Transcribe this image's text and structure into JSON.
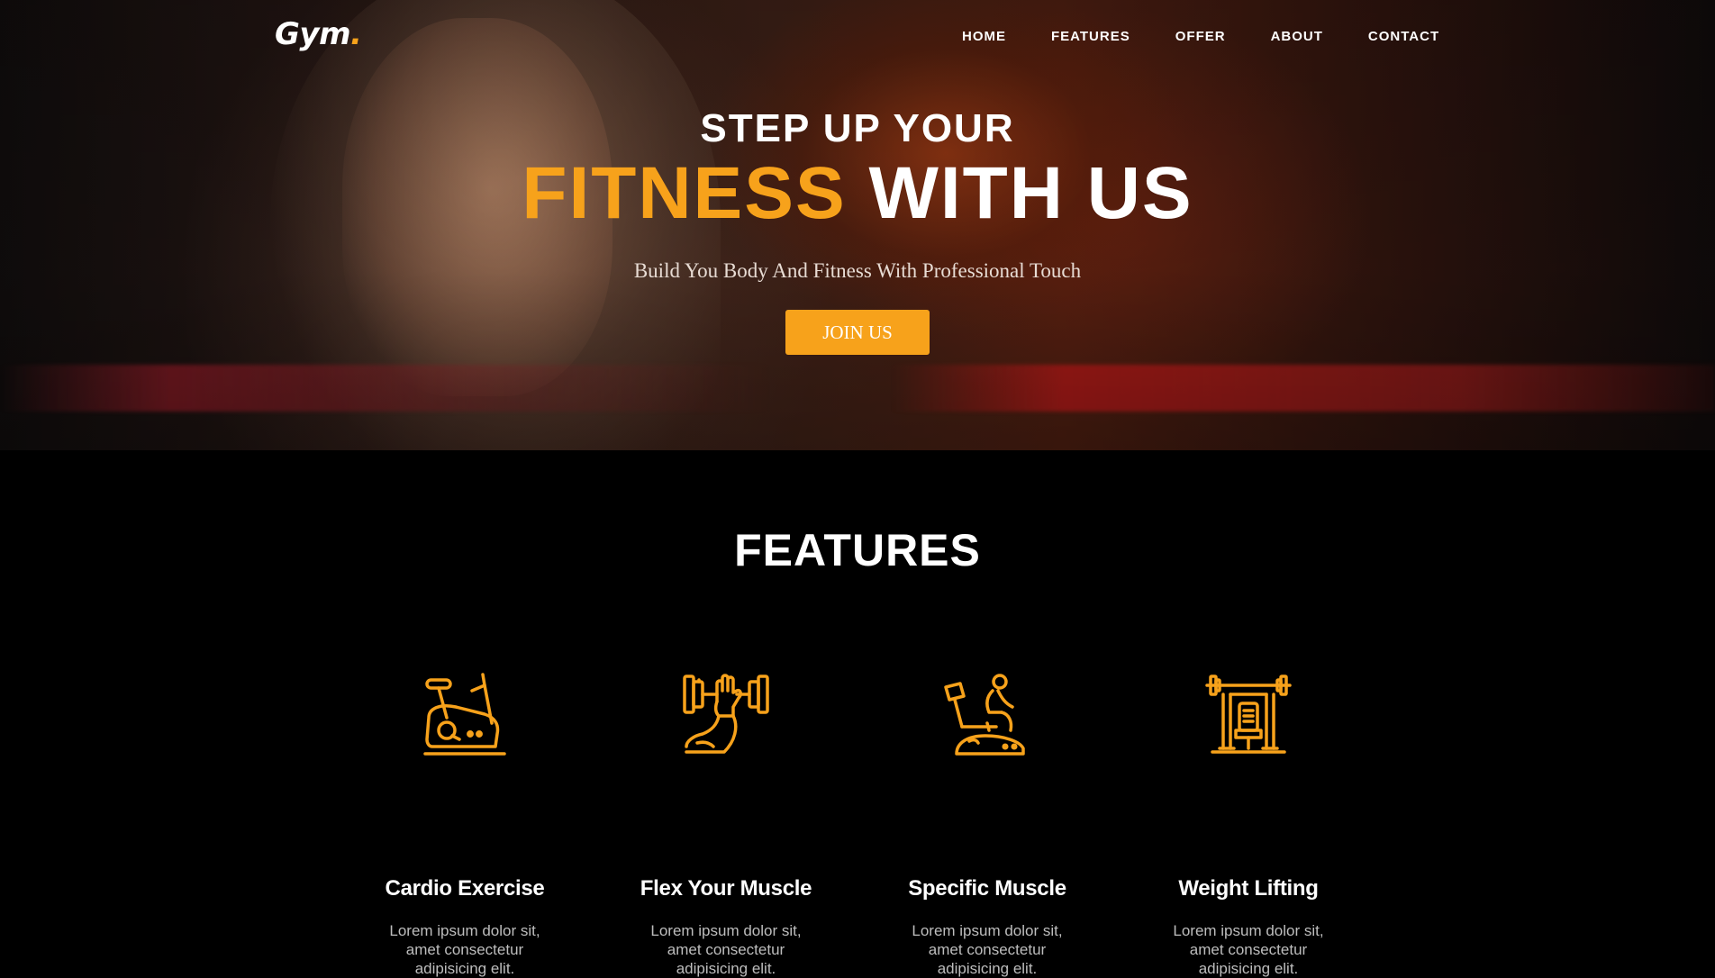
{
  "nav": {
    "logo_text": "Gym",
    "logo_dot": ".",
    "items": [
      "HOME",
      "FEATURES",
      "OFFER",
      "ABOUT",
      "CONTACT"
    ]
  },
  "hero": {
    "subtitle": "STEP UP YOUR",
    "title_accent": "FITNESS",
    "title_rest": "WITH US",
    "tagline": "Build You Body And Fitness With Professional Touch",
    "cta_label": "JOIN US"
  },
  "features": {
    "title": "FEATURES",
    "cards": [
      {
        "name": "Cardio Exercise",
        "desc": "Lorem ipsum dolor sit, amet consectetur adipisicing elit.",
        "icon": "exercise-bike-icon"
      },
      {
        "name": "Flex Your Muscle",
        "desc": "Lorem ipsum dolor sit, amet consectetur adipisicing elit.",
        "icon": "dumbbell-arm-icon"
      },
      {
        "name": "Specific Muscle",
        "desc": "Lorem ipsum dolor sit, amet consectetur adipisicing elit.",
        "icon": "person-on-bike-icon"
      },
      {
        "name": "Weight Lifting",
        "desc": "Lorem ipsum dolor sit, amet consectetur adipisicing elit.",
        "icon": "weight-rack-icon"
      }
    ]
  },
  "colors": {
    "accent": "#f7a21b",
    "background": "#000000",
    "text": "#ffffff",
    "muted_text": "#bdbdbd"
  }
}
